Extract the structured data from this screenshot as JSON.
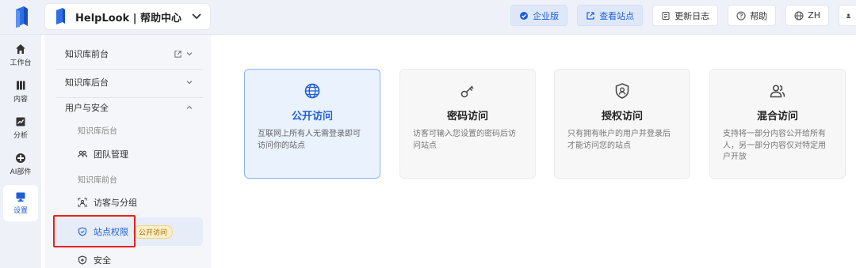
{
  "header": {
    "space_name": "HelpLook | 帮助中心",
    "actions": [
      {
        "label": "企业版",
        "icon": "check-badge-icon"
      },
      {
        "label": "查看站点",
        "icon": "external-link-icon"
      },
      {
        "label": "更新日志",
        "icon": "document-icon"
      },
      {
        "label": "帮助",
        "icon": "question-icon"
      },
      {
        "label": "ZH",
        "icon": "globe-icon"
      }
    ]
  },
  "rail": {
    "items": [
      {
        "label": "工作台",
        "icon": "home-icon"
      },
      {
        "label": "内容",
        "icon": "book-icon"
      },
      {
        "label": "分析",
        "icon": "chart-icon"
      },
      {
        "label": "AI部件",
        "icon": "ai-icon"
      },
      {
        "label": "设置",
        "icon": "monitor-icon"
      }
    ]
  },
  "sidebar": {
    "groups": [
      {
        "label": "知识库前台"
      },
      {
        "label": "知识库后台"
      },
      {
        "label": "用户与安全"
      }
    ],
    "sub_labels": [
      "知识库后台",
      "知识库前台"
    ],
    "items": [
      {
        "label": "团队管理",
        "icon": "team-icon"
      },
      {
        "label": "访客与分组",
        "icon": "visitor-icon"
      },
      {
        "label": "站点权限",
        "icon": "shield-icon",
        "badge": "公开访问"
      },
      {
        "label": "安全",
        "icon": "security-icon"
      }
    ]
  },
  "cards": [
    {
      "title": "公开访问",
      "desc": "互联网上所有人无需登录即可访问你的站点",
      "icon": "globe-icon"
    },
    {
      "title": "密码访问",
      "desc": "访客可输入您设置的密码后访问站点",
      "icon": "key-icon"
    },
    {
      "title": "授权访问",
      "desc": "只有拥有帐户的用户并登录后才能访问您的站点",
      "icon": "shield-user-icon"
    },
    {
      "title": "混合访问",
      "desc": "支持将一部分内容公开给所有人，另一部分内容仅对特定用户开放",
      "icon": "users-icon"
    }
  ],
  "colors": {
    "accent": "#1f5fd6",
    "highlight": "#e8201a",
    "badge_bg": "#fcefc8"
  }
}
